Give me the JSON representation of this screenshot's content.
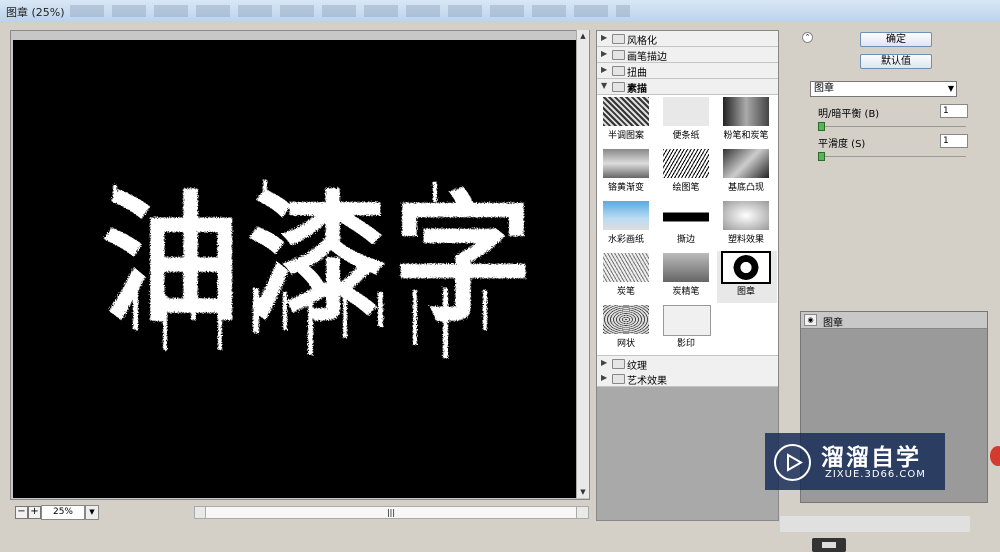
{
  "window": {
    "title": "图章 (25%)"
  },
  "preview": {
    "text": "油漆字",
    "zoom_value": "25%",
    "zoom_out_label": "−",
    "zoom_in_label": "+",
    "scroll_grip": "|||"
  },
  "gallery": {
    "categories_top": [
      {
        "label": "风格化",
        "expanded": false
      },
      {
        "label": "画笔描边",
        "expanded": false
      },
      {
        "label": "扭曲",
        "expanded": false
      },
      {
        "label": "素描",
        "expanded": true
      }
    ],
    "filters": [
      {
        "label": "半调图案",
        "selected": false
      },
      {
        "label": "便条纸",
        "selected": false
      },
      {
        "label": "粉笔和炭笔",
        "selected": false
      },
      {
        "label": "铬黄渐变",
        "selected": false
      },
      {
        "label": "绘图笔",
        "selected": false
      },
      {
        "label": "基底凸现",
        "selected": false
      },
      {
        "label": "水彩画纸",
        "selected": false
      },
      {
        "label": "撕边",
        "selected": false
      },
      {
        "label": "塑料效果",
        "selected": false
      },
      {
        "label": "炭笔",
        "selected": false
      },
      {
        "label": "炭精笔",
        "selected": false
      },
      {
        "label": "图章",
        "selected": true
      },
      {
        "label": "网状",
        "selected": false
      },
      {
        "label": "影印",
        "selected": false
      }
    ],
    "categories_bottom": [
      {
        "label": "纹理",
        "expanded": false
      },
      {
        "label": "艺术效果",
        "expanded": false
      }
    ]
  },
  "settings": {
    "ok_label": "确定",
    "default_label": "默认值",
    "filter_select": "图章",
    "params": [
      {
        "label": "明/暗平衡 (B)",
        "value": "1"
      },
      {
        "label": "平滑度 (S)",
        "value": "1"
      }
    ],
    "layer_name": "图章"
  },
  "watermark": {
    "name": "溜溜自学",
    "url": "ZIXUE.3D66.COM"
  },
  "colors": {
    "canvas_bg": "#000000",
    "text_fill": "#ffffff",
    "dialog_bg": "#d4d0c8",
    "watermark_bg": "#142855"
  }
}
